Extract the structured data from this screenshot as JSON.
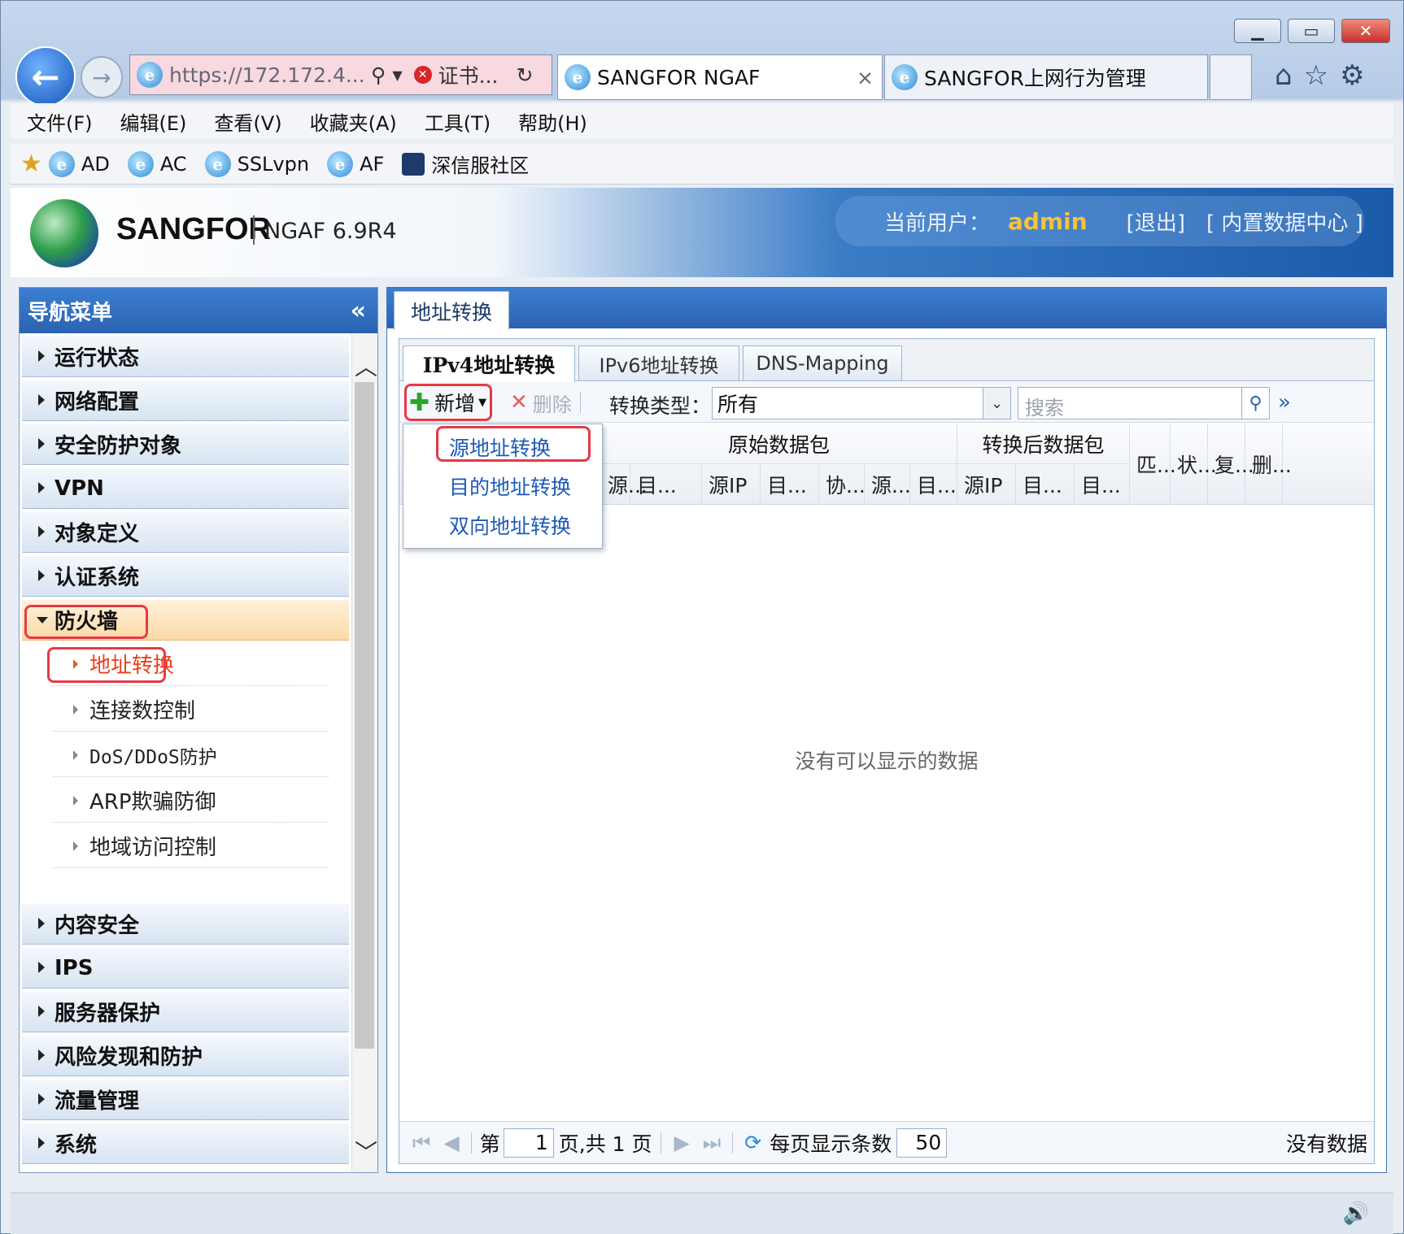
{
  "browser": {
    "url": "https://172.172.4....",
    "cert_label": "证书...",
    "tabs": [
      {
        "title": "SANGFOR NGAF",
        "close": "×"
      },
      {
        "title": "SANGFOR上网行为管理"
      }
    ]
  },
  "menu": [
    "文件(F)",
    "编辑(E)",
    "查看(V)",
    "收藏夹(A)",
    "工具(T)",
    "帮助(H)"
  ],
  "favorites": [
    "AD",
    "AC",
    "SSLvpn",
    "AF",
    "深信服社区"
  ],
  "app": {
    "brand": "SANGFOR",
    "product": "NGAF 6.9R4",
    "user_label": "当前用户：",
    "user": "admin",
    "logout": "[退出]",
    "datacenter": "[ 内置数据中心 ]"
  },
  "nav": {
    "title": "导航菜单",
    "collapse": "«",
    "items_top": [
      "运行状态",
      "网络配置",
      "安全防护对象",
      "VPN",
      "对象定义",
      "认证系统"
    ],
    "active": "防火墙",
    "sub": [
      "地址转换",
      "连接数控制",
      "DoS/DDoS防护",
      "ARP欺骗防御",
      "地域访问控制"
    ],
    "items_bottom": [
      "内容安全",
      "IPS",
      "服务器保护",
      "风险发现和防护",
      "流量管理",
      "系统"
    ]
  },
  "main": {
    "page_tab": "地址转换",
    "subtabs": [
      "IPv4地址转换",
      "IPv6地址转换",
      "DNS-Mapping"
    ],
    "toolbar": {
      "add": "新增",
      "delete": "删除",
      "type_label": "转换类型：",
      "type_value": "所有",
      "search_placeholder": "搜索",
      "more": "»"
    },
    "dropdown": [
      "源地址转换",
      "目的地址转换",
      "双向地址转换"
    ],
    "group_headers": [
      "原始数据包",
      "转换后数据包"
    ],
    "columns": [
      "源...",
      "目...",
      "源IP",
      "目...",
      "协...",
      "源...",
      "目...",
      "源IP",
      "目...",
      "目...",
      "匹...",
      "状...",
      "复...",
      "删..."
    ],
    "empty": "没有可以显示的数据",
    "pager": {
      "page_prefix": "第",
      "page": "1",
      "page_suffix": "页,共 1 页",
      "per_page_label": "每页显示条数",
      "per_page": "50",
      "status": "没有数据"
    }
  }
}
